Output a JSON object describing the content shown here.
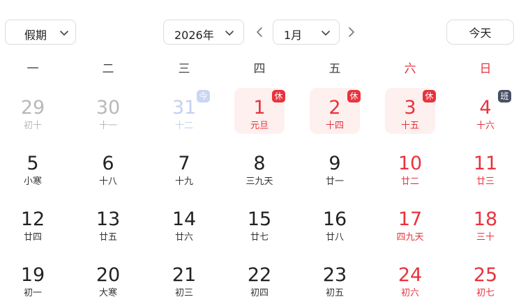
{
  "toolbar": {
    "holiday_select": "假期",
    "year_select": "2026年",
    "month_select": "1月",
    "today_button": "今天"
  },
  "weekdays": [
    "一",
    "二",
    "三",
    "四",
    "五",
    "六",
    "日"
  ],
  "weeks": [
    [
      {
        "day": "29",
        "sub": "初十",
        "other": true
      },
      {
        "day": "30",
        "sub": "十一",
        "other": true
      },
      {
        "day": "31",
        "sub": "十二",
        "today": true,
        "badge": "今"
      },
      {
        "day": "1",
        "sub": "元旦",
        "holiday": true,
        "badge": "休"
      },
      {
        "day": "2",
        "sub": "十四",
        "holiday": true,
        "badge": "休"
      },
      {
        "day": "3",
        "sub": "十五",
        "holiday": true,
        "badge": "休"
      },
      {
        "day": "4",
        "sub": "十六",
        "workday": true,
        "badge": "班"
      }
    ],
    [
      {
        "day": "5",
        "sub": "小寒"
      },
      {
        "day": "6",
        "sub": "十八"
      },
      {
        "day": "7",
        "sub": "十九"
      },
      {
        "day": "8",
        "sub": "三九天"
      },
      {
        "day": "9",
        "sub": "廿一"
      },
      {
        "day": "10",
        "sub": "廿二"
      },
      {
        "day": "11",
        "sub": "廿三"
      }
    ],
    [
      {
        "day": "12",
        "sub": "廿四"
      },
      {
        "day": "13",
        "sub": "廿五"
      },
      {
        "day": "14",
        "sub": "廿六"
      },
      {
        "day": "15",
        "sub": "廿七"
      },
      {
        "day": "16",
        "sub": "廿八"
      },
      {
        "day": "17",
        "sub": "四九天"
      },
      {
        "day": "18",
        "sub": "三十"
      }
    ],
    [
      {
        "day": "19",
        "sub": "初一"
      },
      {
        "day": "20",
        "sub": "大寒"
      },
      {
        "day": "21",
        "sub": "初三"
      },
      {
        "day": "22",
        "sub": "初四"
      },
      {
        "day": "23",
        "sub": "初五"
      },
      {
        "day": "24",
        "sub": "初六"
      },
      {
        "day": "25",
        "sub": "初七"
      }
    ]
  ],
  "colors": {
    "accent_red": "#e8333d",
    "holiday_bg": "#fdf0ef",
    "work_badge": "#4a5165",
    "today_badge": "#c9d6f4",
    "muted_text": "#b8b8b8"
  }
}
